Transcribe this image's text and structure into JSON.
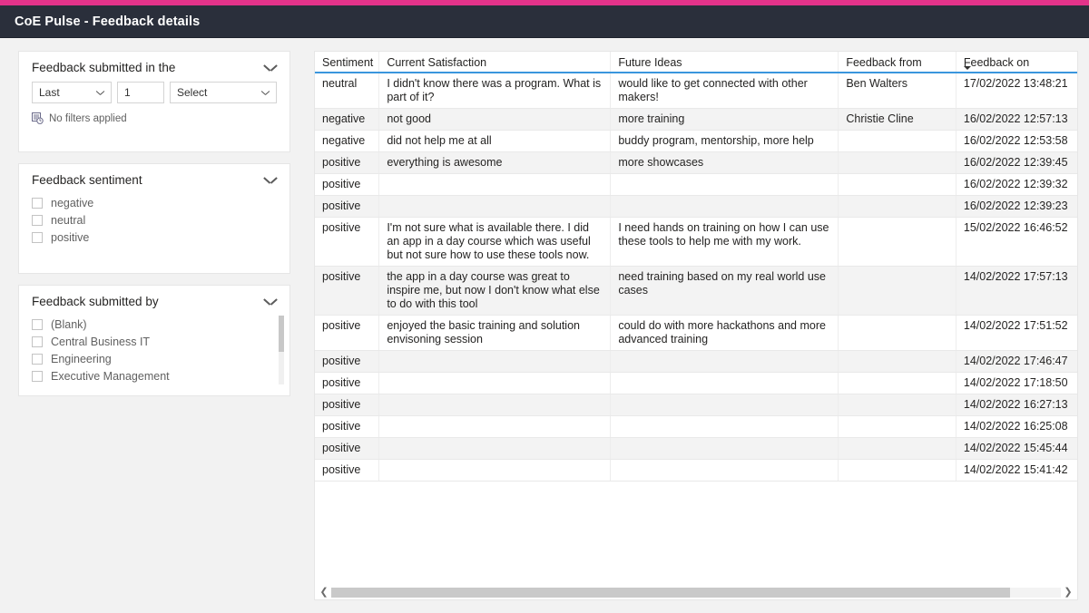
{
  "app": {
    "title": "CoE Pulse - Feedback details",
    "accent_color": "#e3338a",
    "header_bg": "#2a2f3b"
  },
  "filters": {
    "date_card": {
      "title": "Feedback submitted in the",
      "collapse_icon": "chevron-down-icon",
      "range_type": "Last",
      "range_count": "1",
      "range_unit": "Select",
      "status_icon": "filter-clock-icon",
      "status_text": "No filters applied"
    },
    "sentiment_card": {
      "title": "Feedback sentiment",
      "collapse_icon": "chevron-down-icon",
      "options": [
        {
          "label": "negative",
          "checked": false
        },
        {
          "label": "neutral",
          "checked": false
        },
        {
          "label": "positive",
          "checked": false
        }
      ]
    },
    "submitted_by_card": {
      "title": "Feedback submitted by",
      "collapse_icon": "chevron-down-icon",
      "options": [
        {
          "label": "(Blank)",
          "checked": false
        },
        {
          "label": "Central Business IT",
          "checked": false
        },
        {
          "label": "Engineering",
          "checked": false
        },
        {
          "label": "Executive Management",
          "checked": false
        }
      ]
    }
  },
  "table": {
    "columns": [
      {
        "key": "sentiment",
        "label": "Sentiment",
        "sorted": false
      },
      {
        "key": "satisfaction",
        "label": "Current Satisfaction",
        "sorted": false
      },
      {
        "key": "ideas",
        "label": "Future Ideas",
        "sorted": false
      },
      {
        "key": "from",
        "label": "Feedback from",
        "sorted": false
      },
      {
        "key": "on",
        "label": "Feedback on",
        "sorted": true,
        "sort_direction": "desc",
        "sort_icon": "sort-descending-icon"
      }
    ],
    "rows": [
      {
        "sentiment": "neutral",
        "satisfaction": "I didn't know there was a program. What is part of it?",
        "ideas": "would like to get connected with other makers!",
        "from": "Ben Walters",
        "on": "17/02/2022 13:48:21"
      },
      {
        "sentiment": "negative",
        "satisfaction": "not good",
        "ideas": "more training",
        "from": "Christie Cline",
        "on": "16/02/2022 12:57:13"
      },
      {
        "sentiment": "negative",
        "satisfaction": "did not help me at all",
        "ideas": "buddy program, mentorship, more help",
        "from": "",
        "on": "16/02/2022 12:53:58"
      },
      {
        "sentiment": "positive",
        "satisfaction": "everything is awesome",
        "ideas": "more showcases",
        "from": "",
        "on": "16/02/2022 12:39:45"
      },
      {
        "sentiment": "positive",
        "satisfaction": "",
        "ideas": "",
        "from": "",
        "on": "16/02/2022 12:39:32"
      },
      {
        "sentiment": "positive",
        "satisfaction": "",
        "ideas": "",
        "from": "",
        "on": "16/02/2022 12:39:23"
      },
      {
        "sentiment": "positive",
        "satisfaction": "I'm not sure what is available there. I did an app in a day course which was useful but not sure how to use these tools now.",
        "ideas": "I need hands on training on how I can use these tools to help me with my work.",
        "from": "",
        "on": "15/02/2022 16:46:52"
      },
      {
        "sentiment": "positive",
        "satisfaction": "the app in a day course was great to inspire me, but now I don't know what else to do with this tool",
        "ideas": "need training based on my real world use cases",
        "from": "",
        "on": "14/02/2022 17:57:13"
      },
      {
        "sentiment": "positive",
        "satisfaction": "enjoyed the basic training and solution envisoning session",
        "ideas": "could do with more hackathons and more advanced training",
        "from": "",
        "on": "14/02/2022 17:51:52"
      },
      {
        "sentiment": "positive",
        "satisfaction": "",
        "ideas": "",
        "from": "",
        "on": "14/02/2022 17:46:47"
      },
      {
        "sentiment": "positive",
        "satisfaction": "",
        "ideas": "",
        "from": "",
        "on": "14/02/2022 17:18:50"
      },
      {
        "sentiment": "positive",
        "satisfaction": "",
        "ideas": "",
        "from": "",
        "on": "14/02/2022 16:27:13"
      },
      {
        "sentiment": "positive",
        "satisfaction": "",
        "ideas": "",
        "from": "",
        "on": "14/02/2022 16:25:08"
      },
      {
        "sentiment": "positive",
        "satisfaction": "",
        "ideas": "",
        "from": "",
        "on": "14/02/2022 15:45:44"
      },
      {
        "sentiment": "positive",
        "satisfaction": "",
        "ideas": "",
        "from": "",
        "on": "14/02/2022 15:41:42"
      }
    ],
    "scrollbar": {
      "left_arrow_icon": "chevron-left-icon",
      "right_arrow_icon": "chevron-right-icon"
    }
  }
}
